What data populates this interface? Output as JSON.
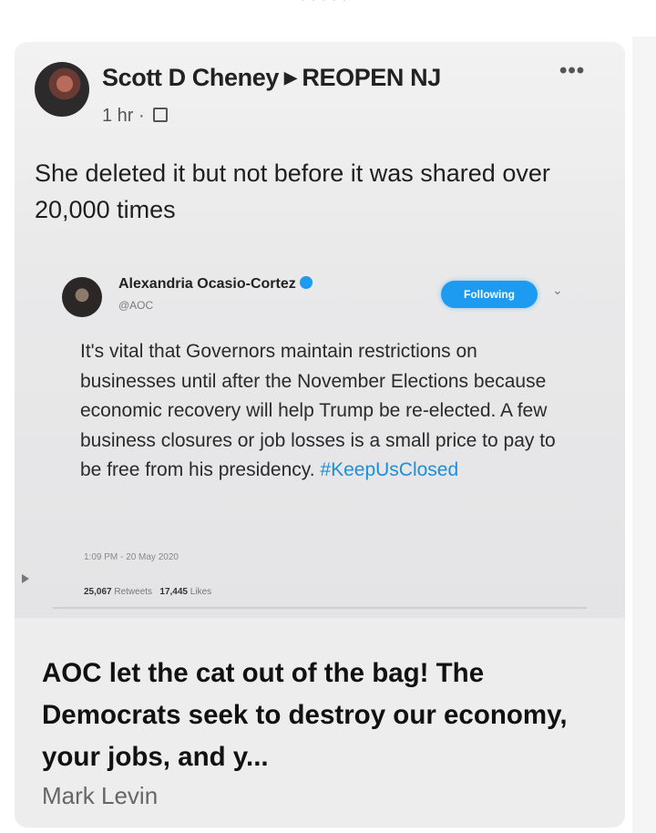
{
  "post": {
    "author": "Scott D Cheney",
    "group": "REOPEN NJ",
    "time": "1 hr",
    "more_label": "•••",
    "text": "She deleted it but not before it was shared over 20,000 times"
  },
  "tweet": {
    "name": "Alexandria Ocasio-Cortez",
    "handle": "@AOC",
    "follow_label": "Following",
    "body_text": "It's vital that Governors maintain restrictions on businesses until after the November Elections because economic recovery will help Trump be re-elected. A few business closures or job losses is a small price to pay to be free from his presidency. ",
    "hashtag": "#KeepUsClosed",
    "timestamp": "1:09 PM - 20 May 2020",
    "retweets_count": "25,067",
    "retweets_label": "Retweets",
    "likes_count": "17,445",
    "likes_label": "Likes"
  },
  "link_preview": {
    "headline": "AOC let the cat out of the bag! The Democrats seek to destroy our economy, your jobs, and y...",
    "source": "Mark Levin"
  },
  "colors": {
    "accent": "#1d9bf0",
    "card_bg": "#ededed"
  }
}
